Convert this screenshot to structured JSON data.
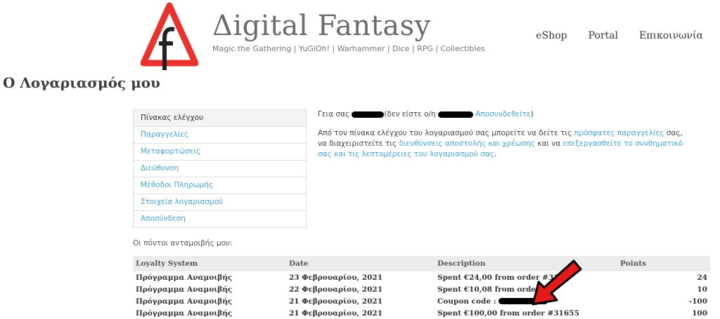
{
  "header": {
    "title": "Δigital Fantasy",
    "tagline": "Magic the Gathering | YuGiOh! | Warhammer | Dice | RPG | Collectibles",
    "nav": [
      "eShop",
      "Portal",
      "Επικοινωνία"
    ]
  },
  "page_title": "Ο Λογαριασμός μου",
  "account_nav": [
    "Πίνακας ελέγχου",
    "Παραγγελίες",
    "Μεταφορτώσεις",
    "Διεύθυνση",
    "Μέθοδοι Πληρωμής",
    "Στοιχεία λογαριασμού",
    "Αποσύνδεση"
  ],
  "greeting": {
    "hello": "Γεια σας",
    "not_you": "(δεν είστε ο/η",
    "logout": "Αποσυνδεθείτε",
    "close": ")"
  },
  "intro": {
    "p1": "Από τον πίνακα ελέγχου του λογαριασμού σας μπορείτε να δείτε τις ",
    "l1": "πρόσφατες παραγγελίες",
    "p2": " σας, να διαχειριστείτε τις ",
    "l2": "διευθύνσεις αποστολής και χρέωσης",
    "p3": " και να ",
    "l3": "επεξεργασθείτε το συνθηματικό σας και τις λεπτομέρειες του λογαριασμού σας",
    "p4": "."
  },
  "points_label": "Οι πόντοι ανταμοιβής μου:",
  "table": {
    "headers": [
      "Loyalty System",
      "Date",
      "Description",
      "Points"
    ],
    "rows": [
      [
        "Πρόγραμμα Αναμοιβής",
        "23 Φεβρουαρίου, 2021",
        "Spent €24,00 from order #31",
        "24"
      ],
      [
        "Πρόγραμμα Αναμοιβής",
        "22 Φεβρουαρίου, 2021",
        "Spent €10,08 from order #3",
        "10"
      ],
      [
        "Πρόγραμμα Αναμοιβής",
        "21 Φεβρουαρίου, 2021",
        "Coupon code :",
        "-100"
      ],
      [
        "Πρόγραμμα Αναμοιβής",
        "21 Φεβρουαρίου, 2021",
        "Spent €100,00 from order #31655",
        "100"
      ]
    ]
  },
  "colors": {
    "link": "#4ba3d6",
    "logo_red": "#e8322e",
    "arrow": "#e11b1b"
  },
  "icons": {
    "logo": "warning-triangle-f-logo",
    "annotation": "red-arrow-icon"
  }
}
